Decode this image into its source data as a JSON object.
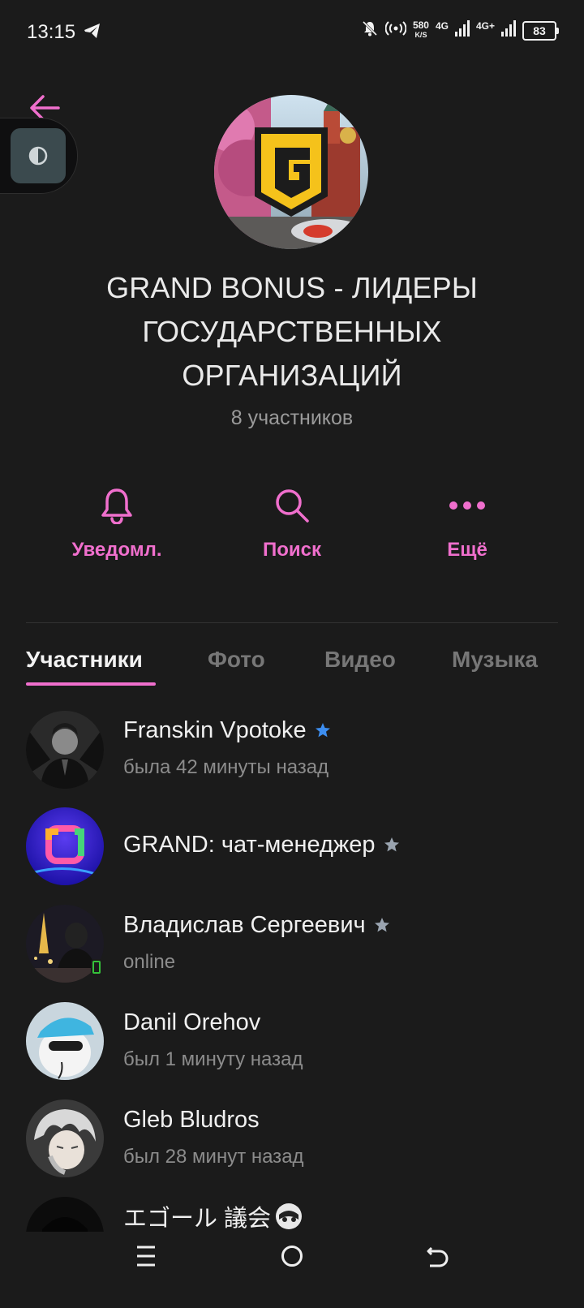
{
  "status_bar": {
    "time": "13:15",
    "speed_value": "580",
    "speed_unit": "K/S",
    "net1": "4G",
    "net2": "4G+",
    "battery": "83"
  },
  "group": {
    "title": "GRAND BONUS - ЛИДЕРЫ ГОСУДАРСТВЕННЫХ ОРГАНИЗАЦИЙ",
    "members_count": "8 участников"
  },
  "actions": [
    {
      "label": "Уведомл.",
      "icon": "bell-icon"
    },
    {
      "label": "Поиск",
      "icon": "search-icon"
    },
    {
      "label": "Ещё",
      "icon": "more-icon"
    }
  ],
  "tabs": [
    "Участники",
    "Фото",
    "Видео",
    "Музыка"
  ],
  "members": [
    {
      "name": "Franskin Vpotoke",
      "status": "была 42 минуты назад",
      "star_color": "#3d8ef0"
    },
    {
      "name": "GRAND: чат-менеджер",
      "status": "",
      "star_color": "#9aa4b0"
    },
    {
      "name": "Владислав Сергеевич",
      "status": "online",
      "star_color": "#9aa4b0"
    },
    {
      "name": "Danil Orehov",
      "status": "был 1 минуту назад"
    },
    {
      "name": "Gleb Bludros",
      "status": "был 28 минут назад"
    },
    {
      "name": "エゴール 議会",
      "status": ""
    }
  ],
  "colors": {
    "accent": "#f06fcd",
    "background": "#1b1b1b",
    "online_indicator": "#35c23a"
  }
}
